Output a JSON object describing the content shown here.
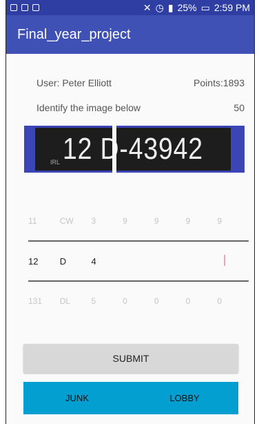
{
  "status": {
    "left_icons": [
      "image-icon",
      "tablet-icon",
      "mail-icon"
    ],
    "right_text": "25%",
    "time": "2:59 PM"
  },
  "app": {
    "title": "Final_year_project"
  },
  "info": {
    "user": "User: Peter Elliott",
    "points": "Points:1893",
    "prompt": "Identify the image below",
    "timer": "50"
  },
  "plate": {
    "text": "12 D-43942",
    "country": "IRL"
  },
  "picker": {
    "top": [
      "11",
      "CW",
      "3",
      "9",
      "9",
      "9",
      "9"
    ],
    "selected": [
      "12",
      "D",
      "4",
      "",
      "",
      "",
      ""
    ],
    "bottom": [
      "131",
      "DL",
      "5",
      "0",
      "0",
      "0",
      "0"
    ]
  },
  "actions": {
    "submit": "SUBMIT",
    "junk": "JUNK",
    "lobby": "LOBBY"
  }
}
